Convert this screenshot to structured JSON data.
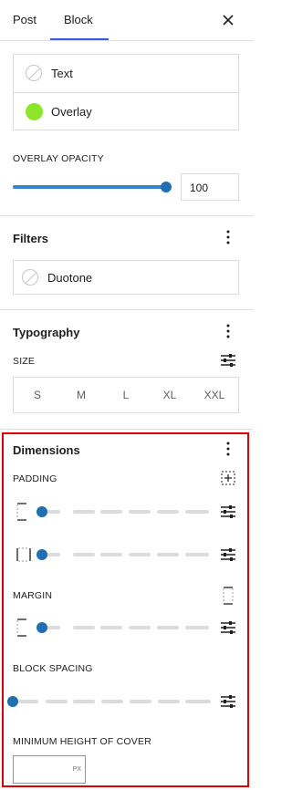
{
  "tabs": [
    {
      "label": "Post"
    },
    {
      "label": "Block"
    }
  ],
  "color": {
    "text_label": "Text",
    "overlay_label": "Overlay",
    "overlay_color": "#8ee62a"
  },
  "overlay_opacity": {
    "label": "OVERLAY OPACITY",
    "value": "100",
    "level": 1.0
  },
  "filters": {
    "title": "Filters",
    "duotone_label": "Duotone"
  },
  "typography": {
    "title": "Typography",
    "size_label": "SIZE",
    "sizes": [
      "S",
      "M",
      "L",
      "XL",
      "XXL"
    ]
  },
  "dimensions": {
    "title": "Dimensions",
    "padding_label": "PADDING",
    "margin_label": "MARGIN",
    "block_spacing_label": "BLOCK SPACING",
    "min_height_label": "MINIMUM HEIGHT OF COVER",
    "min_height_unit": "PX",
    "min_height_value": ""
  },
  "colors": {
    "accent": "#3858e9",
    "slider": "#1f6fb1",
    "highlight": "#e00000"
  },
  "icons": [
    "close-icon",
    "more-vertical-icon",
    "sliders-icon",
    "box-sides-icon",
    "side-top-icon",
    "side-left-icon"
  ]
}
